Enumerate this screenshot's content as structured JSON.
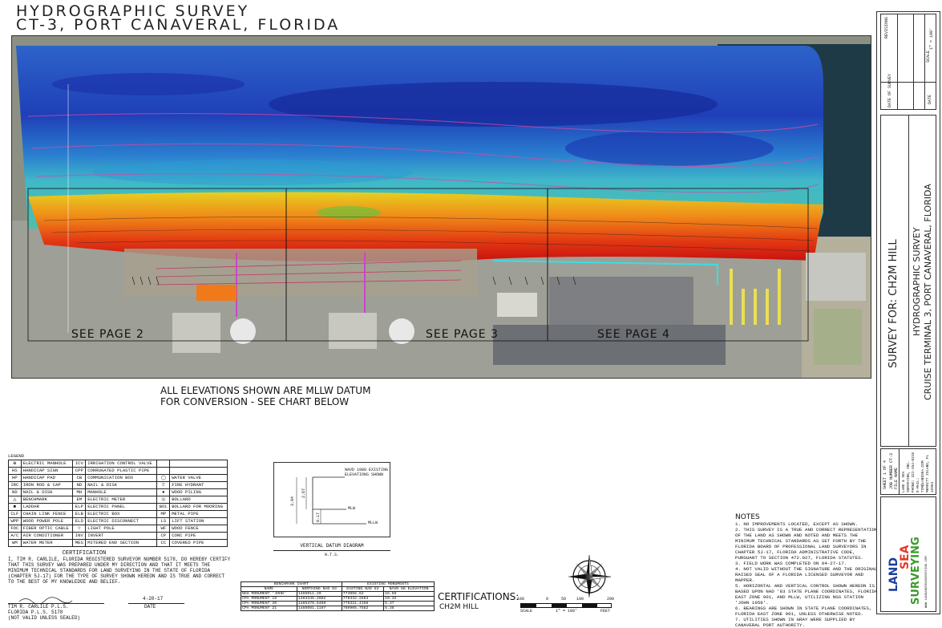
{
  "title": {
    "line1": "HYDROGRAPHIC SURVEY",
    "line2": "CT-3, PORT CANAVERAL, FLORIDA"
  },
  "map": {
    "see_pages": [
      "SEE PAGE 2",
      "SEE PAGE 3",
      "SEE PAGE 4"
    ]
  },
  "elevations_note": {
    "line1": "ALL ELEVATIONS SHOWN ARE MLLW DATUM",
    "line2": "FOR CONVERSION - SEE CHART BELOW"
  },
  "legend": {
    "title": "LEGEND",
    "rows": [
      [
        "⊕",
        "ELECTRIC MANHOLE",
        "ICV",
        "IRRIGATION CONTROL VALVE",
        "",
        ""
      ],
      [
        "HS",
        "HANDICAP SIGN",
        "CPP",
        "CORRUGATED PLASTIC PIPE",
        "",
        ""
      ],
      [
        "HP",
        "HANDICAP PAD",
        "CB",
        "COMMUNICATION BOX",
        "◯",
        "WATER VALVE"
      ],
      [
        "IRC",
        "IRON ROD & CAP",
        "ND",
        "NAIL & DISK",
        "♖",
        "FIRE HYDRANT"
      ],
      [
        "ND",
        "NAIL & DISK",
        "MH",
        "MANHOLE",
        "●",
        "WOOD PILING"
      ],
      [
        "◬",
        "BENCHMARK",
        "EM",
        "ELECTRIC METER",
        "◎",
        "BOLLARD"
      ],
      [
        "■",
        "LADDAR",
        "ELP",
        "ELECTRIC PANEL",
        "BOL",
        "BOLLARD FOR MOORING"
      ],
      [
        "CLF",
        "CHAIN LINK FENCE",
        "ELB",
        "ELECTRIC BOX",
        "MP",
        "METAL PIPE"
      ],
      [
        "WPP",
        "WOOD POWER POLE",
        "ELD",
        "ELECTRIC DISCONNECT",
        "LS",
        "LIFT STATION"
      ],
      [
        "FOC",
        "FIBER OPTIC CABLE",
        "☆",
        "LIGHT POLE",
        "WF",
        "WOOD FENCE"
      ],
      [
        "A/C",
        "AIR CONDITIONER",
        "INV",
        "INVERT",
        "CP",
        "CONC PIPE"
      ],
      [
        "WM",
        "WATER METER",
        "MES",
        "MITERED END SECTION",
        "CC",
        "COVERED PIPE"
      ]
    ]
  },
  "certification": {
    "heading": "CERTIFICATION",
    "body": "I, TIM R. CARLILE, FLORIDA REGISTERED SURVEYOR NUMBER 5178, DO HEREBY CERTIFY THAT THIS SURVEY WAS PREPARED UNDER MY DIRECTION AND THAT IT MEETS THE MINIMUM TECHNICAL STANDARDS FOR LAND SURVEYING IN THE STATE OF FLORIDA (CHAPTER 5J-17) FOR THE TYPE OF SURVEY SHOWN HEREON AND IS TRUE AND CORRECT TO THE BEST OF MY KNOWLEDGE AND BELIEF.",
    "date_value": "4-20-17",
    "name": "TIM R. CARLILE P.L.S.",
    "license": "FLORIDA P.L.S. 5178",
    "not_valid": "(NOT VALID UNLESS SEALED)",
    "date_label": "DATE"
  },
  "datum": {
    "caption": "VERTICAL DATUM DIAGRAM",
    "nts": "N.T.S.",
    "navd": "NAVD 1988 EXISTING ELEVATIONS SHOWN",
    "mlw": "MLW",
    "mllw": "MLLW",
    "v1": "3.84",
    "v2": "2.67",
    "v3": "0.17"
  },
  "benchmark": {
    "header": [
      "BENCHMARK CHART",
      "EXISTING MONUMENTS"
    ],
    "cols": [
      "NAME",
      "NORTHING NAD 83",
      "EASTING NAD 83",
      "NAVD 88 ELEVATION"
    ],
    "rows": [
      [
        "NGS MONUMENT 'JOHN'",
        "1485011.29",
        "774956.62",
        "15.65"
      ],
      [
        "CPA MONUMENT 19",
        "1483346.2082",
        "778332.2663",
        "10.32"
      ],
      [
        "CPA MONUMENT 20",
        "1485376.5488",
        "779321.4156",
        "5.37"
      ],
      [
        "CPA MONUMENT 21",
        "1485081.1197",
        "780905.7582",
        "5.38"
      ]
    ]
  },
  "certifications": {
    "label": "CERTIFICATIONS:",
    "value": "CH2M HILL"
  },
  "scale": {
    "labels": [
      "100",
      "0",
      "50",
      "100",
      "200"
    ],
    "text": "SCALE",
    "ratio": "1\" = 100'",
    "unit": "FEET"
  },
  "notes": {
    "heading": "NOTES",
    "items": [
      "1. NO IMPROVEMENTS LOCATED, EXCEPT AS SHOWN.",
      "2. THIS SURVEY IS A TRUE AND CORRECT REPRESENTATION OF THE LAND AS SHOWN AND NOTED AND MEETS THE MINIMUM TECHNICAL STANDARDS AS SET FORTH BY THE FLORIDA BOARD OF PROFESSIONAL LAND SURVEYORS IN CHAPTER 5J-17, FLORIDA ADMINISTRATIVE CODE, PURSUANT TO SECTION 472.027, FLORIDA STATUTES.",
      "3. FIELD WORK WAS COMPLETED ON 04-27-17.",
      "4. NOT VALID WITHOUT THE SIGNATURE AND THE ORIGINAL RAISED SEAL OF A FLORIDA LICENSED SURVEYOR AND MAPPER.",
      "5. HORIZONTAL AND VERTICAL CONTROL SHOWN HEREON IS BASED UPON NAD '83 STATE PLANE COORDINATES, FLORIDA EAST ZONE 901, AND MLLW, UTILIZING NGS STATION 'JOHN 1958'.",
      "6. BEARINGS ARE SHOWN IN STATE PLANE COORDINATES, FLORIDA EAST ZONE 901, UNLESS OTHERWISE NOTED.",
      "7. UTILITIES SHOWN IN GRAY WERE SUPPLIED BY CANAVERAL PORT AUTHORITY."
    ]
  },
  "titleblock": {
    "survey_for": "SURVEY FOR: CH2M HILL",
    "project_line1": "HYDROGRAPHIC SURVEY",
    "project_line2": "CRUISE TERMINAL 3, PORT CANAVERAL, FLORIDA",
    "revisions": "REVISIONS",
    "date_of_survey": "DATE OF SURVEY",
    "scale_label": "SCALE",
    "scale_value": "1\" = 100'",
    "date_label": "DATE",
    "sheet": "SHEET 1 OF 4",
    "job_number": "JOB NUMBER CT-3",
    "file_name": "FILE NAME",
    "company_info": "LAND & SEA SURVEYING, INC.  PHONE: 321-454-0318  E-MAIL: TIM@LANDSEA.COM  MERRITT ISLAND, FL 32953",
    "logo_land": "LAND",
    "logo_sea": "SEA",
    "logo_surveying": "SURVEYING",
    "website": "WWW.LANDANDSEASURVEYING.COM"
  }
}
